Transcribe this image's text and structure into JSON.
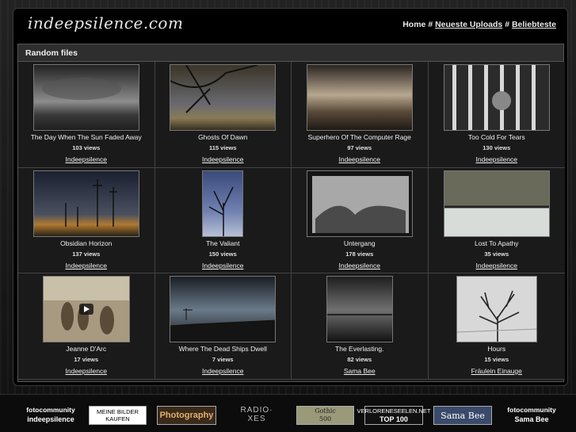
{
  "site": {
    "logo": "indeepsilence.com"
  },
  "nav": {
    "home": "Home",
    "sep1": "#",
    "uploads": "Neueste Uploads",
    "sep2": "#",
    "popular": "Beliebteste"
  },
  "panel": {
    "title": "Random files"
  },
  "items": [
    {
      "title": "The Day When The Sun Faded Away",
      "views": "103 views",
      "user": "Indeepsilence"
    },
    {
      "title": "Ghosts Of Dawn",
      "views": "115 views",
      "user": "Indeepsilence"
    },
    {
      "title": "Superhero Of The Computer Rage",
      "views": "97 views",
      "user": "Indeepsilence"
    },
    {
      "title": "Too Cold For Tears",
      "views": "130 views",
      "user": "Indeepsilence"
    },
    {
      "title": "Obsidian Horizon",
      "views": "137 views",
      "user": "Indeepsilence"
    },
    {
      "title": "The Valiant",
      "views": "150 views",
      "user": "Indeepsilence"
    },
    {
      "title": "Untergang",
      "views": "178 views",
      "user": "Indeepsilence"
    },
    {
      "title": "Lost To Apathy",
      "views": "35 views",
      "user": "Indeepsilence"
    },
    {
      "title": "Jeanne D'Arc",
      "views": "17 views",
      "user": "Indeepsilence"
    },
    {
      "title": "Where The Dead Ships Dwell",
      "views": "7 views",
      "user": "Indeepsilence"
    },
    {
      "title": "The Everlasting.",
      "views": "82 views",
      "user": "Sama Bee"
    },
    {
      "title": "Hours",
      "views": "15 views",
      "user": "Fräulein Einauge"
    }
  ],
  "footer": {
    "fc1_top": "fotocommunity",
    "fc1_bottom": "indeepsilence",
    "meine1": "MEINE BILDER",
    "meine2": "KAUFEN",
    "photography": "Photography",
    "radio1": "RADIO·",
    "radio2": "XES",
    "gothic1": "Gothic",
    "gothic2": "500",
    "verl1": "VERLORENESEELEN.NET",
    "verl2": "TOP 100",
    "samabee": "Sama Bee",
    "fc2_top": "fotocommunity",
    "fc2_bottom": "Sama Bee"
  }
}
